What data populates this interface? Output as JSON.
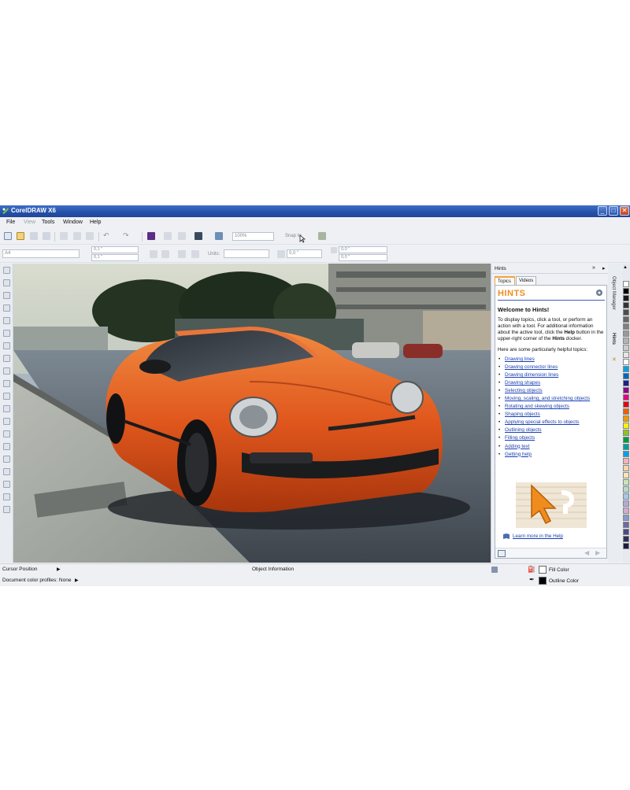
{
  "window": {
    "title": "CorelDRAW X6",
    "minimize": "_",
    "maximize": "□",
    "close": "✕"
  },
  "menu": [
    {
      "label": "File",
      "enabled": true
    },
    {
      "label": "View",
      "enabled": false
    },
    {
      "label": "Tools",
      "enabled": true
    },
    {
      "label": "Window",
      "enabled": true
    },
    {
      "label": "Help",
      "enabled": true
    }
  ],
  "toolbar": {
    "zoom_value": "100%",
    "snap_to": "Snap to"
  },
  "property_bar": {
    "page_size": "A4",
    "width_value": "0,1 \"",
    "height_value": "0,1 \"",
    "units_label": "Units:",
    "nudge_value": "0,0 \"",
    "dup_x": "0,0 \"",
    "dup_y": "0,0 \""
  },
  "hints": {
    "docker_title": "Hints",
    "tabs": [
      "Topics",
      "Videos"
    ],
    "logo": "HINTS",
    "welcome": "Welcome to Hints!",
    "intro_1": "To display topics, click a tool, or perform an action with a tool. For additional information about the active tool, click the ",
    "intro_help": "Help",
    "intro_2": " button in the upper-right corner of the ",
    "intro_hints": "Hints",
    "intro_3": " docker.",
    "helpful": "Here are some particularly helpful topics:",
    "topics": [
      "Drawing lines",
      "Drawing connector lines",
      "Drawing dimension lines",
      "Drawing shapes",
      "Selecting objects",
      "Moving, scaling, and stretching objects",
      "Rotating and skewing objects",
      "Shaping objects",
      "Applying special effects to objects",
      "Outlining objects",
      "Filling objects",
      "Adding text",
      "Getting help"
    ],
    "learn_more": "Learn more in the Help"
  },
  "side_tabs": [
    "Object Manager",
    "Hints"
  ],
  "status": {
    "cursor_position": "Cursor Position",
    "object_info": "Object Information",
    "color_profiles": "Document color profiles: None",
    "fill_color": "Fill Color",
    "outline_color": "Outline Color"
  },
  "palette": [
    "#ffffff",
    "#000000",
    "#1a1a1a",
    "#333333",
    "#4d4d4d",
    "#666666",
    "#808080",
    "#999999",
    "#b3b3b3",
    "#cccccc",
    "#e6e6e6",
    "#ffffff",
    "#00a0e9",
    "#0068b7",
    "#1d2088",
    "#920783",
    "#e4007f",
    "#e60012",
    "#eb6100",
    "#f39800",
    "#fff100",
    "#8fc31f",
    "#009944",
    "#009e96",
    "#00a0e9",
    "#f5b2b2",
    "#fad2b0",
    "#fce5b0",
    "#c9e4b4",
    "#b3d9d1",
    "#a5c8ea",
    "#b4a9d6",
    "#d7a9d0",
    "#8c97cb",
    "#6c6aa8",
    "#4c4a83",
    "#2f2d5c",
    "#1a1a40"
  ],
  "colors": {
    "accent": "#f08c1e",
    "title_bar": "#2450a8",
    "link": "#1a3fb0"
  }
}
